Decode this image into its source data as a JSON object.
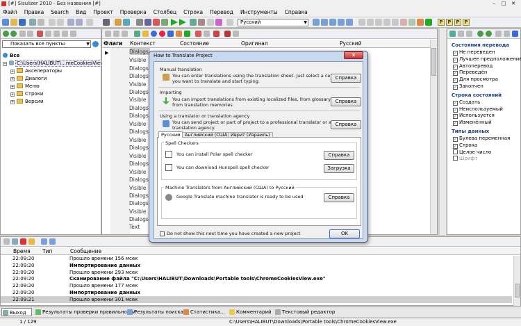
{
  "app": {
    "title": "[#] Sisulizer 2010 - Без названия [#]",
    "window_controls": [
      "–",
      "□",
      "✕"
    ]
  },
  "menu": [
    "Файл",
    "Правка",
    "Search",
    "Вид",
    "Проект",
    "Проверка",
    "Столбец",
    "Строка",
    "Перевод",
    "Инструменты",
    "Справка"
  ],
  "toolbar": {
    "language": "Русский",
    "flags": [
      "P",
      "P",
      "P",
      "P"
    ]
  },
  "left": {
    "filter": "Показать все пункты",
    "tree": {
      "root": "Все",
      "path": "C:\\Users\\HALIBUT\\...meCookiesView.exe",
      "items": [
        "Акселераторы",
        "Диалоги",
        "Меню",
        "Строки",
        "Версии"
      ]
    }
  },
  "grid": {
    "headers": [
      "Флаги",
      "Контекст",
      "Состояние",
      "Оригинал",
      "Русский"
    ],
    "rows": [
      "Dialogs.",
      "Visible",
      "Dialogs.",
      "Dialogs.",
      "Visible",
      "Dialogs.",
      "Visible",
      "Dialogs.",
      "Dialogs.",
      "Visible",
      "Dialogs.",
      "Visible",
      "Dialogs.",
      "Visible",
      "Dialogs.",
      "Visible",
      "Dialogs.",
      "Visible",
      "Dialogs.",
      "Dialogs.",
      "Visible",
      "Dialogs.",
      "Text"
    ]
  },
  "right": {
    "sections": [
      {
        "title": "Состояния перевода",
        "items": [
          "Не переведен",
          "Лучшее предположение",
          "Автоперевод",
          "Переведён",
          "Для просмотра",
          "Закончен"
        ]
      },
      {
        "title": "Строка состояний",
        "items": [
          "Создать",
          "Неиспользуемый",
          "Используется",
          "Изменённый"
        ]
      },
      {
        "title": "Типы данных",
        "items": [
          "Булева переменная",
          "Строка",
          "Целое число",
          "Шрифт"
        ]
      }
    ]
  },
  "log": {
    "headers": [
      "Время",
      "Тип",
      "Сообщение"
    ],
    "rows": [
      {
        "time": "22:09:20",
        "msg": "Прошло времени 156 мсек",
        "bold": false
      },
      {
        "time": "22:09:20",
        "msg": "Импортирование данных",
        "bold": true
      },
      {
        "time": "22:09:20",
        "msg": "Прошло времени 293 мсек",
        "bold": false
      },
      {
        "time": "22:09:20",
        "msg": "Сканирование файла \"C:\\Users\\HALIBUT\\Downloads\\Portable tools\\ChromeCookiesView.exe\"",
        "bold": true
      },
      {
        "time": "22:09:20",
        "msg": "Прошло времени 177 мсек",
        "bold": false
      },
      {
        "time": "22:09:20",
        "msg": "Импортирование данных",
        "bold": true
      },
      {
        "time": "22:09:21",
        "msg": "Прошло времени 301 мсек",
        "bold": false
      }
    ]
  },
  "bottom_tabs": [
    "Выход",
    "Результаты проверки правильности",
    "Результаты поиска",
    "Статистика...",
    "Комментарий",
    "Текстовый редактор"
  ],
  "status": {
    "page": "1 / 129",
    "path": "C:\\Users\\HALIBUT\\Downloads\\Portable tools\\ChromeCookiesView.exe"
  },
  "dialog": {
    "title": "How to Translate Project",
    "close": "x",
    "manual": {
      "heading": "Manual translation",
      "text1": "You can enter translations using the translation sheet. Just select a cell that",
      "text2": "you want to translate and start typing.",
      "button": "Справка"
    },
    "importing": {
      "heading": "Importing",
      "text1": "You can import translations from existing localized files, from glossary files, or",
      "text2": "from translation memories.",
      "button": "Справка"
    },
    "agency": {
      "heading": "Using a translator or translation agency",
      "text1": "You can send project or part of project to a professional translator or a",
      "text2": "translation agency.",
      "button": "Справка"
    },
    "tabs": [
      "Русский",
      "Английский (США)",
      "Иврит (Израиль)"
    ],
    "spell": {
      "heading": "Spell Checkers",
      "polar": "You can install Polar spell checker",
      "polar_button": "Справка",
      "hunspell": "You can download Hunspell spell checker",
      "hunspell_button": "Загрузка"
    },
    "machine": {
      "heading": "Machine Translators from Английский (США) to Русский",
      "google": "Google Translate machine translator is ready to be used",
      "button": "Справка"
    },
    "checkbox": "Do not show this next time you have created a new project",
    "ok": "OK"
  }
}
